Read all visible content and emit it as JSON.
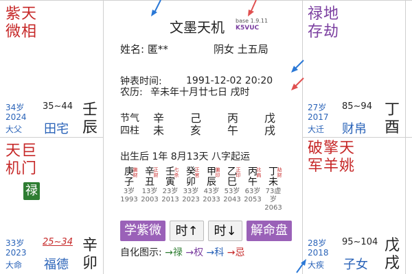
{
  "colors": {
    "red": "#c62828",
    "purple": "#7b3fa0",
    "blue": "#2a63b8",
    "button_purple": "#9a61b8",
    "lu_green": "#2e7d32"
  },
  "palaces": {
    "top_left": {
      "stars": [
        "紫天",
        "微相"
      ],
      "age": "34岁",
      "year": "2024",
      "range": "35~44",
      "stem": "壬",
      "branch": "辰",
      "tag": "大父",
      "name": "田宅"
    },
    "top_right": {
      "stars": [
        "禄地",
        "存劫"
      ],
      "age": "27岁",
      "year": "2017",
      "range": "85~94",
      "stem": "丁",
      "branch": "酉",
      "tag": "大迁",
      "name": "财帛"
    },
    "mid_left": {
      "stars": [
        "天巨",
        "机门"
      ],
      "badge": "禄",
      "age": "33岁",
      "year": "2023",
      "range": "25~34",
      "stem": "辛",
      "branch": "卯",
      "tag": "大命",
      "name": "福德"
    },
    "mid_right": {
      "stars_line1": "破擎天",
      "stars_line2": "军羊姚",
      "age": "28岁",
      "year": "2018",
      "range": "95~104",
      "stem": "戊",
      "branch": "戌",
      "tag": "大疾",
      "name": "子女"
    }
  },
  "center": {
    "title": "文墨天机",
    "version": "base 1.9.11",
    "code": "K5VUC",
    "name_label": "姓名: 匿**",
    "gender_bureau": "阴女  土五局",
    "clock_label": "钟表时间:",
    "clock_value": "1991-12-02  20:20",
    "lunar_label": "农历:",
    "lunar_value": "辛未年十月廿七日 戌时",
    "pillars_label1": "节气",
    "pillars_label2": "四柱",
    "pillars": [
      {
        "stem": "辛",
        "branch": "未"
      },
      {
        "stem": "己",
        "branch": "亥"
      },
      {
        "stem": "丙",
        "branch": "午"
      },
      {
        "stem": "戊",
        "branch": "戌"
      }
    ],
    "qiyun": "出生后 1年 8月13天 八字起运",
    "dayun": [
      {
        "stem": "庚",
        "branch": "子",
        "god": "偏财",
        "age": "3岁",
        "year": "1993"
      },
      {
        "stem": "辛",
        "branch": "丑",
        "god": "正财",
        "age": "13岁",
        "year": "2003"
      },
      {
        "stem": "壬",
        "branch": "寅",
        "god": "七杀",
        "age": "23岁",
        "year": "2013"
      },
      {
        "stem": "癸",
        "branch": "卯",
        "god": "正官",
        "age": "33岁",
        "year": "2023"
      },
      {
        "stem": "甲",
        "branch": "辰",
        "god": "偏印",
        "age": "43岁",
        "year": "2033"
      },
      {
        "stem": "乙",
        "branch": "巳",
        "god": "正印",
        "age": "53岁",
        "year": "2043"
      },
      {
        "stem": "丙",
        "branch": "午",
        "god": "比肩",
        "age": "63岁",
        "year": "2053"
      },
      {
        "stem": "丁",
        "branch": "未",
        "god": "劫财",
        "age": "73虚岁",
        "year": "2063"
      }
    ],
    "buttons": {
      "learn": "学紫微",
      "time_up": "时↑",
      "time_down": "时↓",
      "explain": "解命盘"
    },
    "legend_label": "自化图示:",
    "legend_items": [
      "禄",
      "权",
      "科",
      "忌"
    ],
    "legend_colors": [
      "#2e7d32",
      "#7b3fa0",
      "#2a63b8",
      "#c62828"
    ]
  }
}
